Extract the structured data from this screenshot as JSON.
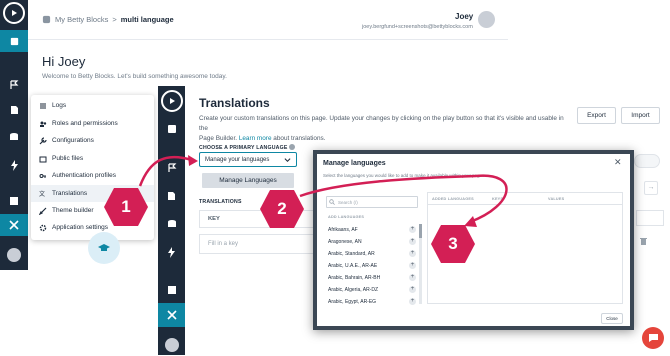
{
  "background_app": {
    "breadcrumb": {
      "root": "My Betty Blocks",
      "separator": ">",
      "current": "multi language"
    },
    "user": {
      "name": "Joey",
      "email": "joey.bergfund+screenshots@bettyblocks.com"
    },
    "greeting": "Hi Joey",
    "welcome": "Welcome to Betty Blocks. Let's build something awesome today.",
    "menu_items": [
      {
        "label": "Logs",
        "icon": "list-icon"
      },
      {
        "label": "Roles and permissions",
        "icon": "people-icon"
      },
      {
        "label": "Configurations",
        "icon": "wrench-icon"
      },
      {
        "label": "Public files",
        "icon": "folder-icon"
      },
      {
        "label": "Authentication profiles",
        "icon": "key-icon"
      },
      {
        "label": "Translations",
        "icon": "translate-icon"
      },
      {
        "label": "Theme builder",
        "icon": "brush-icon"
      },
      {
        "label": "Application settings",
        "icon": "gear-icon"
      }
    ]
  },
  "translations": {
    "title": "Translations",
    "description_1": "Create your custom translations on this page. Update your changes by clicking on the play button so that it's visible and usable in the",
    "description_2": "Page Builder.",
    "learn_more": "Learn more",
    "description_3": "about translations.",
    "export_label": "Export",
    "import_label": "Import",
    "primary_language_label": "CHOOSE A PRIMARY LANGUAGE",
    "select_value": "Manage your languages",
    "dropdown_option": "Manage Languages",
    "translations_label": "TRANSLATIONS",
    "key_header": "KEY",
    "fill_placeholder": "Fill in a key"
  },
  "modal": {
    "title": "Manage languages",
    "subtitle": "Select the languages you would like to add to make it available within your pages",
    "search_placeholder": "Search (/)",
    "left_header": "ADD LANGUAGES",
    "added_header": "ADDED LANGUAGES",
    "keys_header": "KEYS",
    "values_header": "VALUES",
    "close_label": "Close",
    "languages": [
      "Afrikaans, AF",
      "Aragonese, AN",
      "Arabic, Standard, AR",
      "Arabic, U.A.E., AR-AE",
      "Arabic, Bahrain, AR-BH",
      "Arabic, Algeria, AR-DZ",
      "Arabic, Egypt, AR-EG"
    ]
  },
  "steps": [
    "1",
    "2",
    "3"
  ],
  "colors": {
    "accent": "#0e87a3",
    "step": "#d31f55",
    "sidebar": "#1d2a3a",
    "chat": "#e5453b"
  }
}
